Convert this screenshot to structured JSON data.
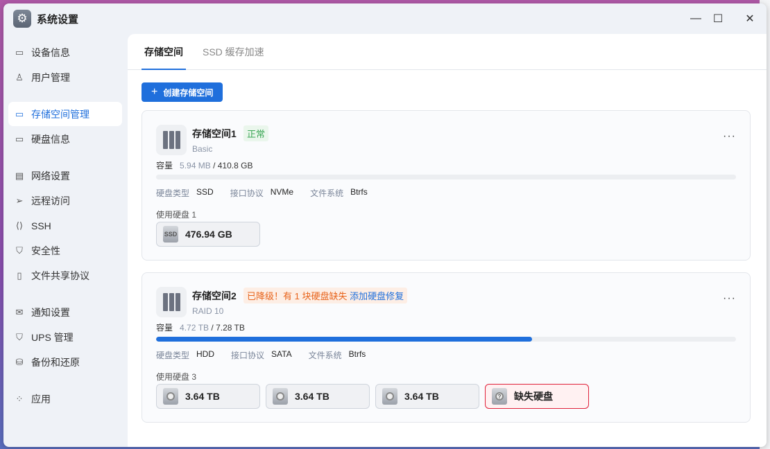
{
  "window": {
    "title": "系统设置"
  },
  "sidebar": {
    "items": [
      {
        "label": "设备信息",
        "icon": "drive-icon"
      },
      {
        "label": "用户管理",
        "icon": "user-icon"
      },
      {
        "label": "存储空间管理",
        "icon": "storage-icon",
        "active": true
      },
      {
        "label": "硬盘信息",
        "icon": "drive-icon"
      },
      {
        "label": "网络设置",
        "icon": "network-icon"
      },
      {
        "label": "远程访问",
        "icon": "send-icon"
      },
      {
        "label": "SSH",
        "icon": "code-icon"
      },
      {
        "label": "安全性",
        "icon": "shield-icon"
      },
      {
        "label": "文件共享协议",
        "icon": "file-icon"
      },
      {
        "label": "通知设置",
        "icon": "mail-icon"
      },
      {
        "label": "UPS 管理",
        "icon": "shield-icon"
      },
      {
        "label": "备份和还原",
        "icon": "backup-icon"
      },
      {
        "label": "应用",
        "icon": "apps-icon"
      }
    ]
  },
  "tabs": [
    "存储空间",
    "SSD 缓存加速"
  ],
  "create_label": "创建存储空间",
  "pools": [
    {
      "name": "存储空间1",
      "status": "正常",
      "type": "Basic",
      "cap_label": "容量",
      "used": "5.94 MB",
      "total": "/ 410.8 GB",
      "usage_fraction": 0.0,
      "props": [
        [
          "硬盘类型",
          "SSD"
        ],
        [
          "接口协议",
          "NVMe"
        ],
        [
          "文件系统",
          "Btrfs"
        ]
      ],
      "used_disks_label": "使用硬盘 1",
      "disks": [
        "476.94 GB"
      ]
    },
    {
      "name": "存储空间2",
      "status": "已降级！有 1 块硬盘缺失",
      "repair_link": "添加硬盘修复",
      "type": "RAID 10",
      "cap_label": "容量",
      "used": "4.72 TB",
      "total": "/ 7.28 TB",
      "usage_fraction": 0.648,
      "props": [
        [
          "硬盘类型",
          "HDD"
        ],
        [
          "接口协议",
          "SATA"
        ],
        [
          "文件系统",
          "Btrfs"
        ]
      ],
      "used_disks_label": "使用硬盘 3",
      "disks": [
        "3.64 TB",
        "3.64 TB",
        "3.64 TB"
      ],
      "missing_label": "缺失硬盘"
    }
  ],
  "colors": {
    "accent": "#1f6fdc",
    "ok": "#3aa655",
    "warn": "#e8641c",
    "danger": "#e0213a"
  }
}
